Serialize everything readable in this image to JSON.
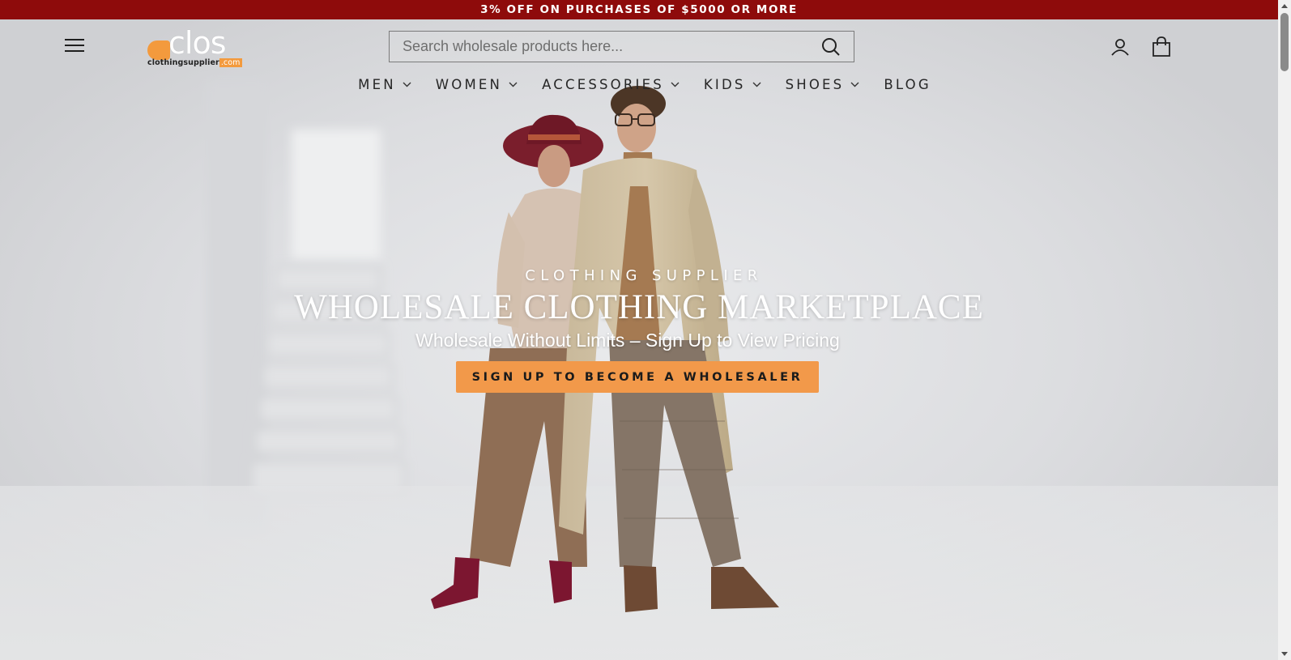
{
  "announcement": {
    "text": "3% OFF ON PURCHASES OF $5000 OR MORE"
  },
  "header": {
    "logo": {
      "wordmark": "clos",
      "subtext": "clothingsupplier",
      "subtext_suffix": ".com"
    },
    "search": {
      "placeholder": "Search wholesale products here...",
      "value": ""
    },
    "icons": {
      "menu": "hamburger-menu-icon",
      "search": "search-icon",
      "account": "user-icon",
      "cart": "shopping-bag-icon"
    }
  },
  "nav": {
    "items": [
      {
        "label": "MEN",
        "has_dropdown": true
      },
      {
        "label": "WOMEN",
        "has_dropdown": true
      },
      {
        "label": "ACCESSORIES",
        "has_dropdown": true
      },
      {
        "label": "KIDS",
        "has_dropdown": true
      },
      {
        "label": "SHOES",
        "has_dropdown": true
      },
      {
        "label": "BLOG",
        "has_dropdown": false
      }
    ]
  },
  "hero": {
    "kicker": "CLOTHING SUPPLIER",
    "title": "WHOLESALE CLOTHING MARKETPLACE",
    "subtitle": "Wholesale Without Limits – Sign Up to View Pricing",
    "cta_label": "SIGN UP TO BECOME A WHOLESALER"
  },
  "colors": {
    "announcement_bg": "#8e0b0b",
    "cta_bg": "#f2994a",
    "logo_accent": "#f39a3d"
  }
}
